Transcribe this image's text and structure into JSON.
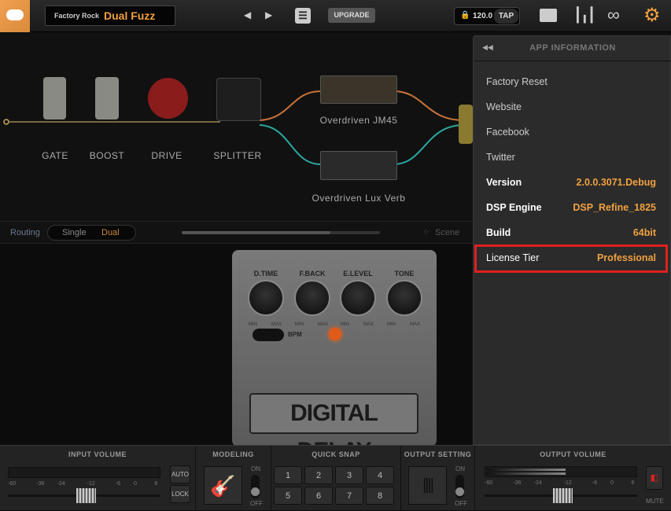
{
  "header": {
    "bank": "Factory Rock",
    "preset": "Dual Fuzz",
    "upgrade_label": "UPGRADE",
    "tempo": "120.0",
    "tap_label": "TAP",
    "icons": [
      "cloud-logo-icon",
      "menu-icon",
      "lock-icon",
      "preset-list-icon",
      "mixer-icon",
      "loop-icon",
      "gear-icon"
    ]
  },
  "chain": {
    "items": [
      {
        "label": "GATE"
      },
      {
        "label": "BOOST"
      },
      {
        "label": "DRIVE"
      },
      {
        "label": "SPLITTER"
      }
    ],
    "amps": [
      {
        "label": "Overdriven JM45"
      },
      {
        "label": "Overdriven Lux Verb"
      }
    ],
    "path_colors": {
      "top": "#c8733a",
      "bottom": "#2aa8a0"
    }
  },
  "routing": {
    "label": "Routing",
    "options": [
      "Single",
      "Dual"
    ],
    "selected": "Dual",
    "scene_label": "Scene"
  },
  "pedal": {
    "knobs": [
      "D.TIME",
      "F.BACK",
      "E.LEVEL",
      "TONE"
    ],
    "min_label": "MIN",
    "max_label": "MAX",
    "switch_label": "BPM",
    "name": "DIGITAL DELAY"
  },
  "app_info": {
    "title": "APP INFORMATION",
    "links": [
      "Factory Reset",
      "Website",
      "Facebook",
      "Twitter"
    ],
    "rows": [
      {
        "label": "Version",
        "value": "2.0.0.3071.Debug"
      },
      {
        "label": "DSP Engine",
        "value": "DSP_Refine_1825"
      },
      {
        "label": "Build",
        "value": "64bit"
      },
      {
        "label": "License Tier",
        "value": "Professional"
      }
    ],
    "accent": "#f0a040",
    "highlight": "#e02020"
  },
  "bottom": {
    "input_volume": "INPUT VOLUME",
    "modeling": "MODELING",
    "quick_snap": "QUICK SNAP",
    "output_setting": "OUTPUT SETTING",
    "output_volume": "OUTPUT VOLUME",
    "ticks": [
      "-60",
      "-36",
      "-24",
      "-12",
      "-6",
      "0",
      "6"
    ],
    "auto": "AUTO",
    "lock": "LOCK",
    "on": "ON",
    "off": "OFF",
    "mute": "MUTE",
    "snaps": [
      "1",
      "2",
      "3",
      "4",
      "5",
      "6",
      "7",
      "8"
    ]
  }
}
